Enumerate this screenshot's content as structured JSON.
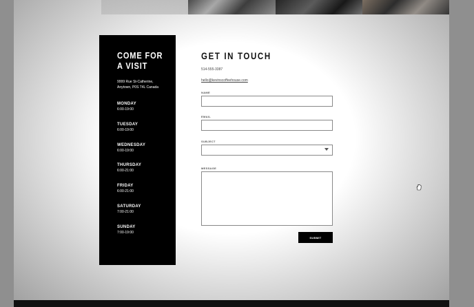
{
  "visit": {
    "title_line1": "COME FOR",
    "title_line2": "A VISIT",
    "address": "9999 Rue St-Catherine, Anytown, P0S T4L Canada",
    "hours": [
      {
        "day": "MONDAY",
        "time": "6:00-19:00"
      },
      {
        "day": "TUESDAY",
        "time": "6:00-19:00"
      },
      {
        "day": "WEDNESDAY",
        "time": "6:00-19:00"
      },
      {
        "day": "THURSDAY",
        "time": "6:00-21:00"
      },
      {
        "day": "FRIDAY",
        "time": "6:00-21:00"
      },
      {
        "day": "SATURDAY",
        "time": "7:00-21:00"
      },
      {
        "day": "SUNDAY",
        "time": "7:00-19:00"
      }
    ]
  },
  "contact": {
    "title": "GET IN TOUCH",
    "phone": "514-555-3387",
    "email": "hello@kevinscoffeehouse.com",
    "form": {
      "name_label": "NAME",
      "email_label": "EMAIL",
      "subject_label": "SUBJECT",
      "message_label": "MESSAGE",
      "submit_label": "SUBMIT"
    }
  }
}
